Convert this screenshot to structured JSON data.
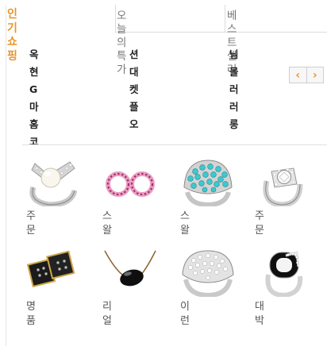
{
  "section": {
    "title": "인기쇼핑"
  },
  "tabs": [
    {
      "label": "오늘의특가"
    },
    {
      "label": "베스트셀러"
    }
  ],
  "vendors": [
    {
      "label": "옥현G마홈코"
    },
    {
      "label": "션대켓플오"
    },
    {
      "label": "님몰러러롱"
    }
  ],
  "nav": {
    "prev": "‹",
    "next": "›"
  },
  "products": [
    {
      "name": "주문",
      "icon": "pearl-ring"
    },
    {
      "name": "스왈",
      "icon": "pink-double-ring"
    },
    {
      "name": "스왈",
      "icon": "turquoise-dome-ring"
    },
    {
      "name": "주문",
      "icon": "solitaire-ring"
    },
    {
      "name": "명품",
      "icon": "black-square-ring"
    },
    {
      "name": "리얼",
      "icon": "black-oval-necklace"
    },
    {
      "name": "이런",
      "icon": "crystal-dome-ring"
    },
    {
      "name": "대박",
      "icon": "black-white-ring"
    }
  ],
  "colors": {
    "accent": "#e8962b",
    "divider": "#dcdcdc"
  }
}
